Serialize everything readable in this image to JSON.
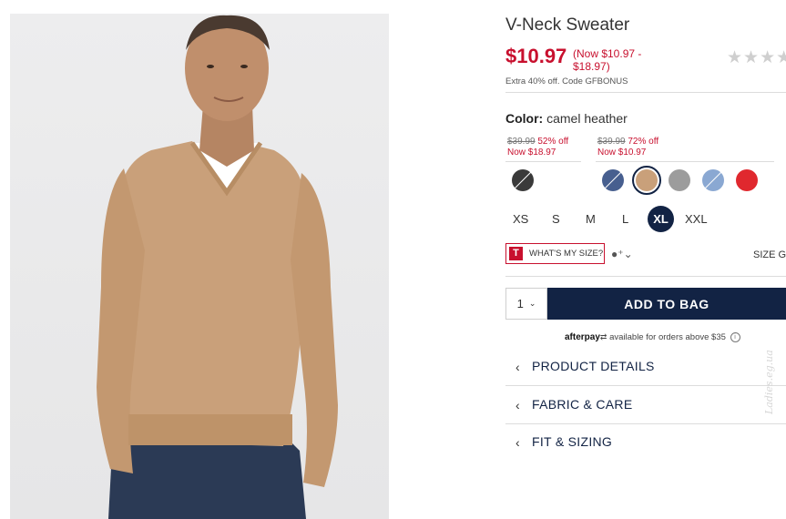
{
  "product": {
    "title": "V-Neck Sweater",
    "price": "$10.97",
    "price_range": "(Now $10.97 - $18.97)",
    "promo": "Extra 40% off. Code GFBONUS",
    "rating_stars": "★★★★"
  },
  "color": {
    "label": "Color:",
    "value": "camel heather",
    "groups": [
      {
        "original": "$39.99",
        "discount": " 52% off",
        "now": "Now $18.97"
      },
      {
        "original": "$39.99",
        "discount": " 72% off",
        "now": "Now $10.97"
      }
    ],
    "swatches": [
      {
        "name": "charcoal",
        "color": "#3a3a3a",
        "strike": true
      },
      {
        "name": "navy heather",
        "color": "#475f8f",
        "strike": true
      },
      {
        "name": "camel heather",
        "color": "#c9a07a",
        "strike": false,
        "selected": true
      },
      {
        "name": "grey",
        "color": "#9c9c9c",
        "strike": false
      },
      {
        "name": "light blue",
        "color": "#8aa8d2",
        "strike": true
      },
      {
        "name": "red",
        "color": "#e0282e",
        "strike": false
      }
    ]
  },
  "sizes": [
    "XS",
    "S",
    "M",
    "L",
    "XL",
    "XXL"
  ],
  "selected_size": "XL",
  "fit": {
    "logo": "T",
    "label": "WHAT'S MY SIZE?",
    "icon": "person-chevron-icon",
    "size_guide": "SIZE G"
  },
  "cart": {
    "quantity": "1",
    "add_label": "ADD TO BAG"
  },
  "afterpay": {
    "brand": "afterpay",
    "text": " available for orders above $35",
    "info": "i"
  },
  "accordions": [
    "PRODUCT DETAILS",
    "FABRIC & CARE",
    "FIT & SIZING"
  ],
  "watermark": "Ladies.eg.ua",
  "colors": {
    "accent_red": "#c8102e",
    "navy": "#122344"
  }
}
